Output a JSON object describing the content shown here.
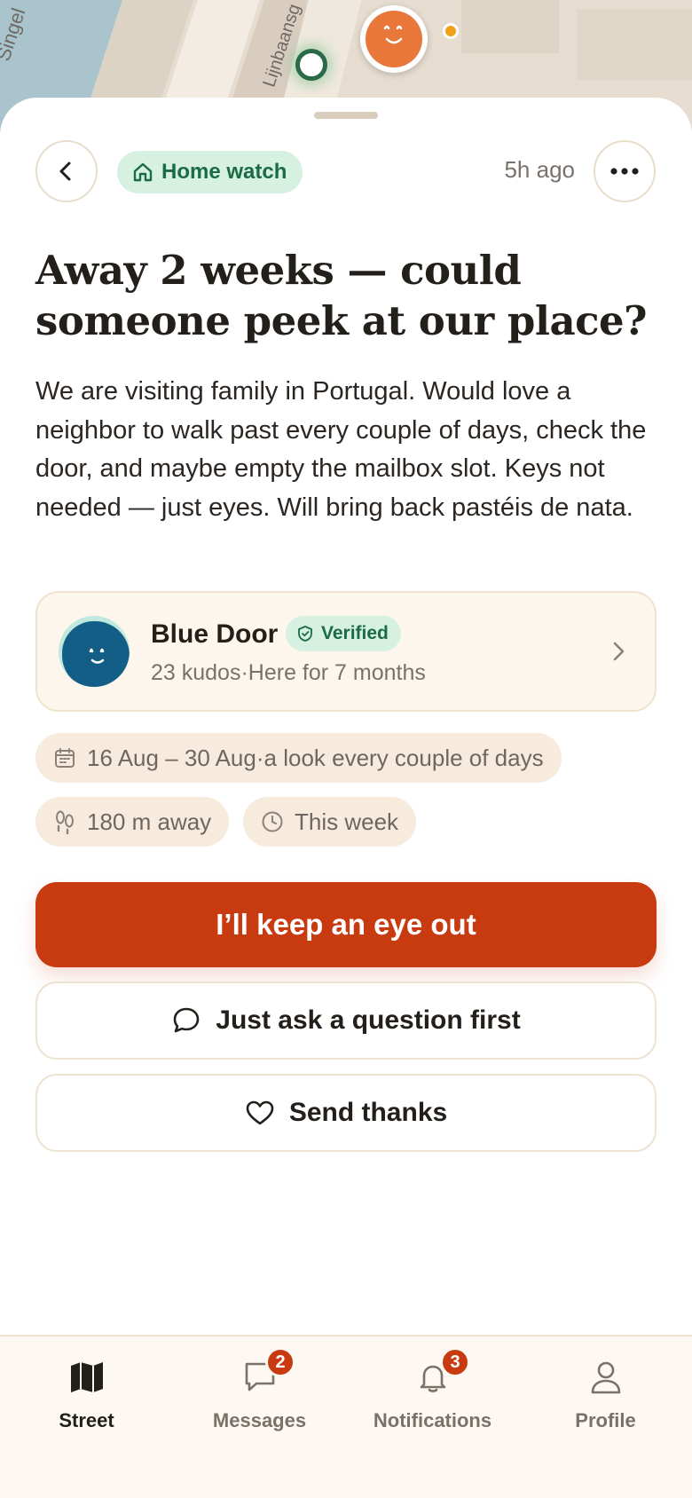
{
  "map": {
    "street_labels": [
      "Singel",
      "Lijnbaansg"
    ]
  },
  "header": {
    "category": "Home watch",
    "posted_time": "5h ago"
  },
  "post": {
    "title": "Away 2 weeks — could someone peek at our place?",
    "body": "We are visiting family in Portugal. Would love a neighbor to walk past every couple of days, check the door, and maybe empty the mailbox slot. Keys not needed — just eyes. Will bring back pastéis de nata."
  },
  "author": {
    "name": "Blue Door",
    "verified_label": "Verified",
    "kudos": "23 kudos",
    "separator": "·",
    "tenure": "Here for 7 months"
  },
  "details": {
    "dates": "16 Aug – 30 Aug",
    "separator": "·",
    "frequency": "a look every couple of days",
    "distance": "180 m away",
    "timeframe": "This week"
  },
  "actions": {
    "primary": "I’ll keep an eye out",
    "ask_question": "Just ask a question first",
    "send_thanks": "Send thanks"
  },
  "tabbar": {
    "items": [
      {
        "label": "Street",
        "active": true
      },
      {
        "label": "Messages",
        "badge": "2"
      },
      {
        "label": "Notifications",
        "badge": "3"
      },
      {
        "label": "Profile"
      }
    ]
  },
  "colors": {
    "accent": "#c83a10",
    "green": "#1b6b45",
    "green_bg": "#d6f1e2",
    "cream": "#fdf6ec"
  }
}
